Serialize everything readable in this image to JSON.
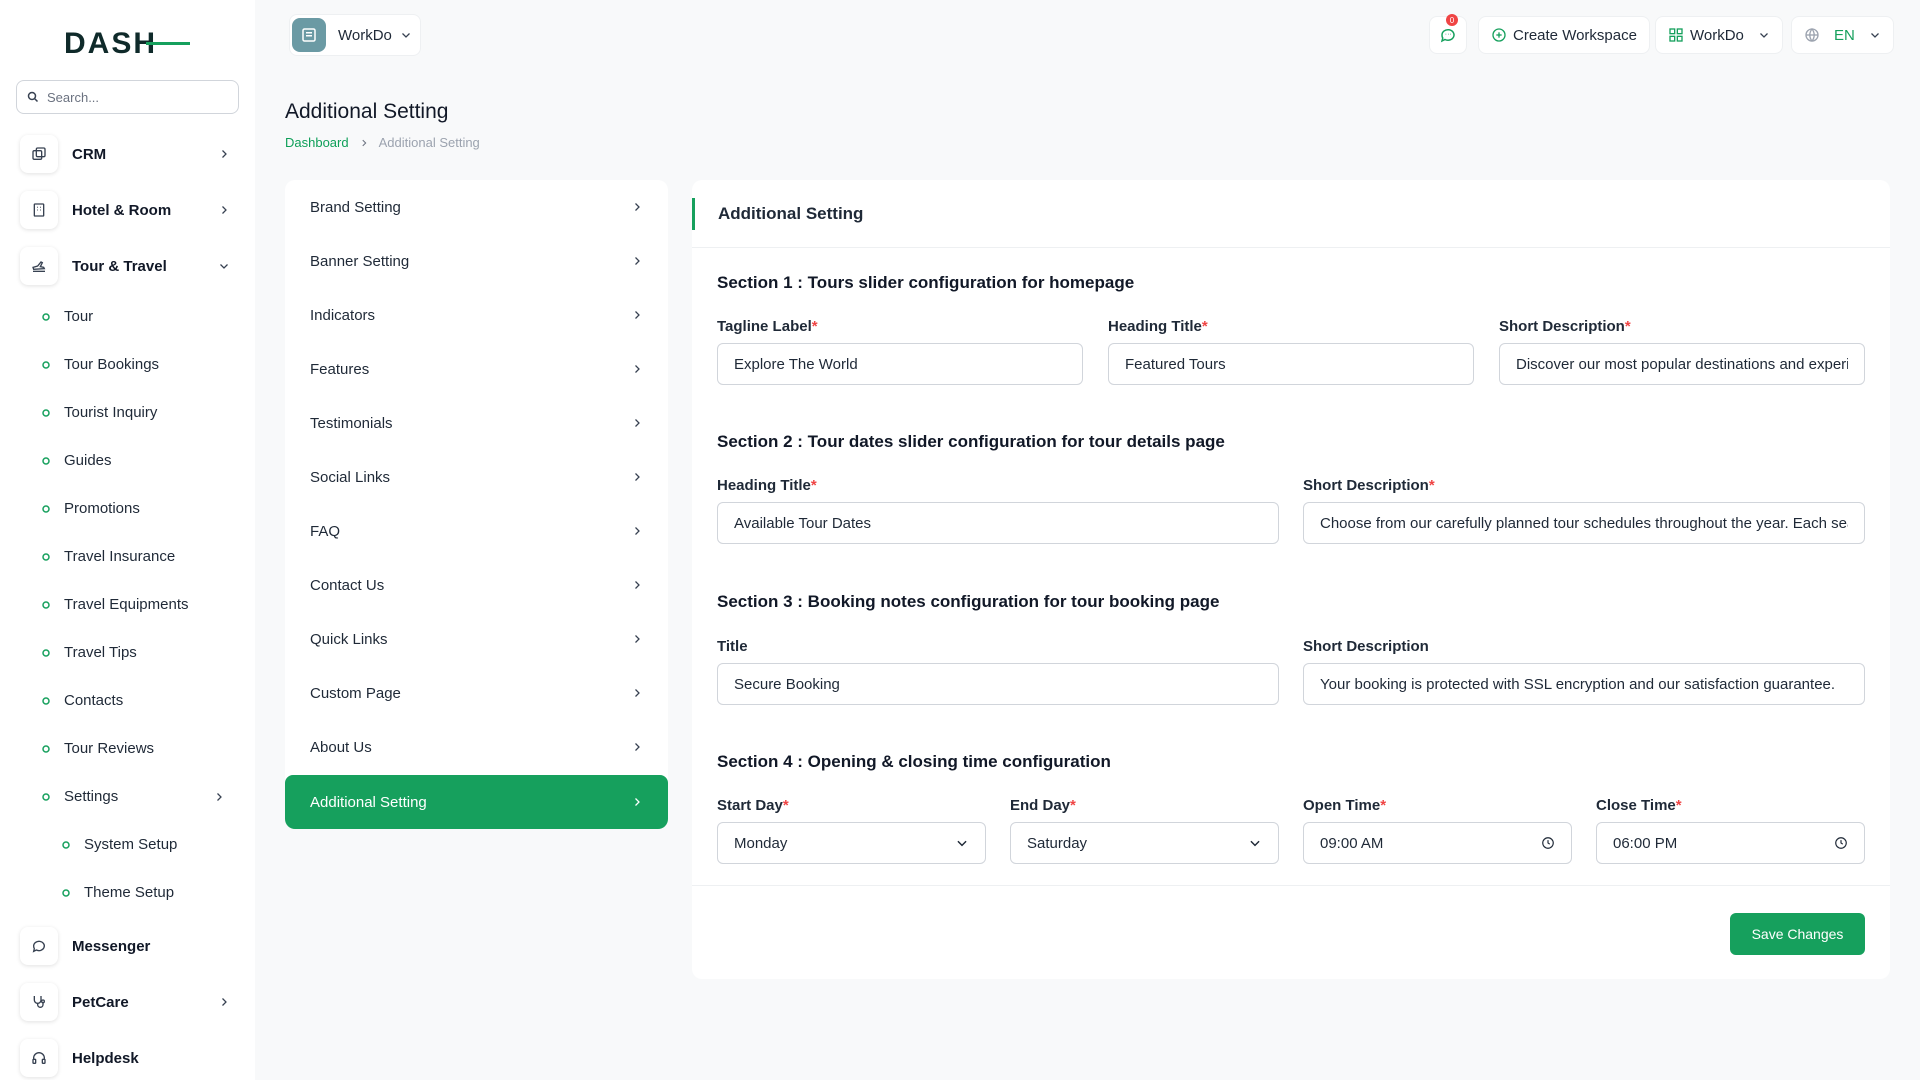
{
  "brand": {
    "logo_text": "DASH",
    "accent": "#16a05d"
  },
  "search": {
    "placeholder": "Search..."
  },
  "sidebar": {
    "top_items": [
      {
        "label": "CRM",
        "icon": "crm-icon"
      },
      {
        "label": "Hotel & Room",
        "icon": "building-icon"
      },
      {
        "label": "Tour & Travel",
        "icon": "plane-icon"
      }
    ],
    "sub_items": [
      {
        "label": "Tour"
      },
      {
        "label": "Tour Bookings"
      },
      {
        "label": "Tourist Inquiry"
      },
      {
        "label": "Guides"
      },
      {
        "label": "Promotions"
      },
      {
        "label": "Travel Insurance"
      },
      {
        "label": "Travel Equipments"
      },
      {
        "label": "Travel Tips"
      },
      {
        "label": "Contacts"
      },
      {
        "label": "Tour Reviews"
      },
      {
        "label": "Settings"
      }
    ],
    "settings_sub": [
      {
        "label": "System Setup"
      },
      {
        "label": "Theme Setup"
      }
    ],
    "bottom_items": [
      {
        "label": "Messenger",
        "icon": "chat-icon"
      },
      {
        "label": "PetCare",
        "icon": "stethoscope-icon"
      },
      {
        "label": "Helpdesk",
        "icon": "headset-icon"
      }
    ]
  },
  "header": {
    "workspace": "WorkDo",
    "notifications_count": "0",
    "create_workspace": "Create Workspace",
    "workspace_menu": "WorkDo",
    "language": "EN"
  },
  "page": {
    "title": "Additional Setting",
    "breadcrumb": {
      "home": "Dashboard",
      "current": "Additional Setting"
    }
  },
  "settings_menu": [
    {
      "label": "Brand Setting"
    },
    {
      "label": "Banner Setting"
    },
    {
      "label": "Indicators"
    },
    {
      "label": "Features"
    },
    {
      "label": "Testimonials"
    },
    {
      "label": "Social Links"
    },
    {
      "label": "FAQ"
    },
    {
      "label": "Contact Us"
    },
    {
      "label": "Quick Links"
    },
    {
      "label": "Custom Page"
    },
    {
      "label": "About Us"
    },
    {
      "label": "Additional Setting",
      "active": true
    }
  ],
  "form": {
    "title": "Additional Setting",
    "section1": {
      "title": "Section 1 : Tours slider configuration for homepage",
      "tagline_label": "Tagline Label",
      "tagline_value": "Explore The World",
      "heading_label": "Heading Title",
      "heading_value": "Featured Tours",
      "desc_label": "Short Description",
      "desc_value": "Discover our most popular destinations and experi"
    },
    "section2": {
      "title": "Section 2 : Tour dates slider configuration for tour details page",
      "heading_label": "Heading Title",
      "heading_value": "Available Tour Dates",
      "desc_label": "Short Description",
      "desc_value": "Choose from our carefully planned tour schedules throughout the year. Each sea:"
    },
    "section3": {
      "title": "Section 3 : Booking notes configuration for tour booking page",
      "title_label": "Title",
      "title_value": "Secure Booking",
      "desc_label": "Short Description",
      "desc_value": "Your booking is protected with SSL encryption and our satisfaction guarantee."
    },
    "section4": {
      "title": "Section 4 : Opening & closing time configuration",
      "start_label": "Start Day",
      "start_value": "Monday",
      "end_label": "End Day",
      "end_value": "Saturday",
      "open_label": "Open Time",
      "open_value": "09:00 AM",
      "close_label": "Close Time",
      "close_value": "06:00 PM"
    },
    "required_mark": "*",
    "save_label": "Save Changes"
  }
}
